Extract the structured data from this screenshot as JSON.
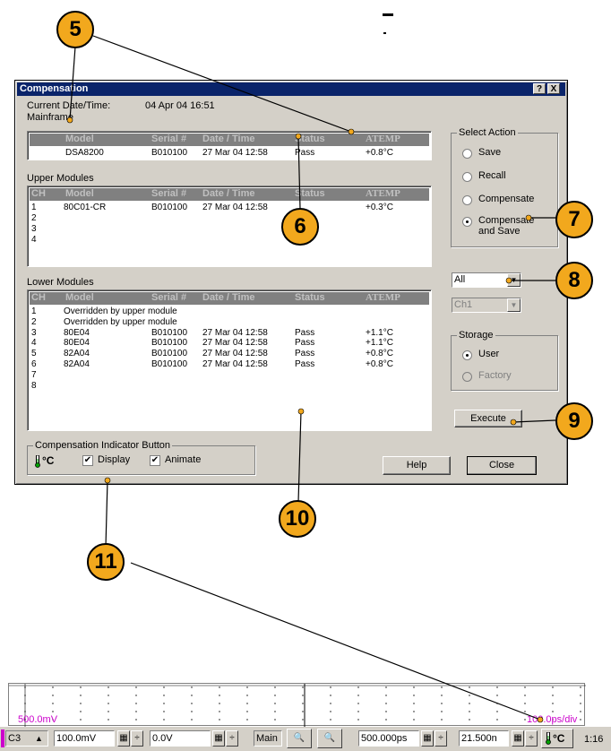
{
  "dialog": {
    "title": "Compensation",
    "help_glyph": "?",
    "close_glyph": "X",
    "current_datetime_label": "Current Date/Time:",
    "current_datetime_value": "04 Apr 04 16:51",
    "mainframe_label": "Mainframe",
    "mainframe": {
      "headers": [
        "Model",
        "Serial #",
        "Date / Time",
        "Status",
        "ATEMP"
      ],
      "row": [
        "DSA8200",
        "B010100",
        "27 Mar 04 12:58",
        "Pass",
        "+0.8°C"
      ]
    },
    "upper_label": "Upper Modules",
    "upper": {
      "headers": [
        "CH",
        "Model",
        "Serial #",
        "Date / Time",
        "Status",
        "ATEMP"
      ],
      "rows": [
        [
          "1",
          "80C01-CR",
          "B010100",
          "27 Mar 04 12:58",
          "",
          "+0.3°C"
        ],
        [
          "2",
          "",
          "",
          "",
          "",
          ""
        ],
        [
          "3",
          "",
          "",
          "",
          "",
          ""
        ],
        [
          "4",
          "",
          "",
          "",
          "",
          ""
        ]
      ]
    },
    "lower_label": "Lower Modules",
    "lower": {
      "headers": [
        "CH",
        "Model",
        "Serial #",
        "Date / Time",
        "Status",
        "ATEMP"
      ],
      "rows": [
        [
          "1",
          "Overridden by upper module",
          "",
          "",
          "",
          ""
        ],
        [
          "2",
          "Overridden by upper module",
          "",
          "",
          "",
          ""
        ],
        [
          "3",
          "80E04",
          "B010100",
          "27 Mar 04 12:58",
          "Pass",
          "+1.1°C"
        ],
        [
          "4",
          "80E04",
          "B010100",
          "27 Mar 04 12:58",
          "Pass",
          "+1.1°C"
        ],
        [
          "5",
          "82A04",
          "B010100",
          "27 Mar 04 12:58",
          "Pass",
          "+0.8°C"
        ],
        [
          "6",
          "82A04",
          "B010100",
          "27 Mar 04 12:58",
          "Pass",
          "+0.8°C"
        ],
        [
          "7",
          "",
          "",
          "",
          "",
          ""
        ],
        [
          "8",
          "",
          "",
          "",
          "",
          ""
        ]
      ]
    },
    "select_action": {
      "title": "Select Action",
      "options": [
        "Save",
        "Recall",
        "Compensate",
        "Compensate and Save"
      ],
      "selected": "Compensate and Save"
    },
    "module_combo": "All",
    "channel_combo": "Ch1",
    "storage": {
      "title": "Storage",
      "options": [
        "User",
        "Factory"
      ],
      "selected": "User"
    },
    "execute_label": "Execute",
    "indicator": {
      "title": "Compensation Indicator Button",
      "icon_text": "°C",
      "display_label": "Display",
      "animate_label": "Animate"
    },
    "help_label": "Help",
    "close_label": "Close"
  },
  "callouts": [
    "5",
    "6",
    "7",
    "8",
    "9",
    "10",
    "11"
  ],
  "scope": {
    "left_label": "500.0mV",
    "right_label": "100.0ps/div"
  },
  "statusbar": {
    "channel": "C3",
    "scale": "100.0mV",
    "offset": "0.0V",
    "timebase_mode": "Main",
    "horizontal_scale": "500.000ps",
    "position": "21.500n",
    "temp_icon_text": "°C",
    "time": "1:16"
  },
  "colors": {
    "callout": "#f2a81d",
    "titlebar": "#0a246a",
    "channel_marker": "#cc00cc"
  }
}
